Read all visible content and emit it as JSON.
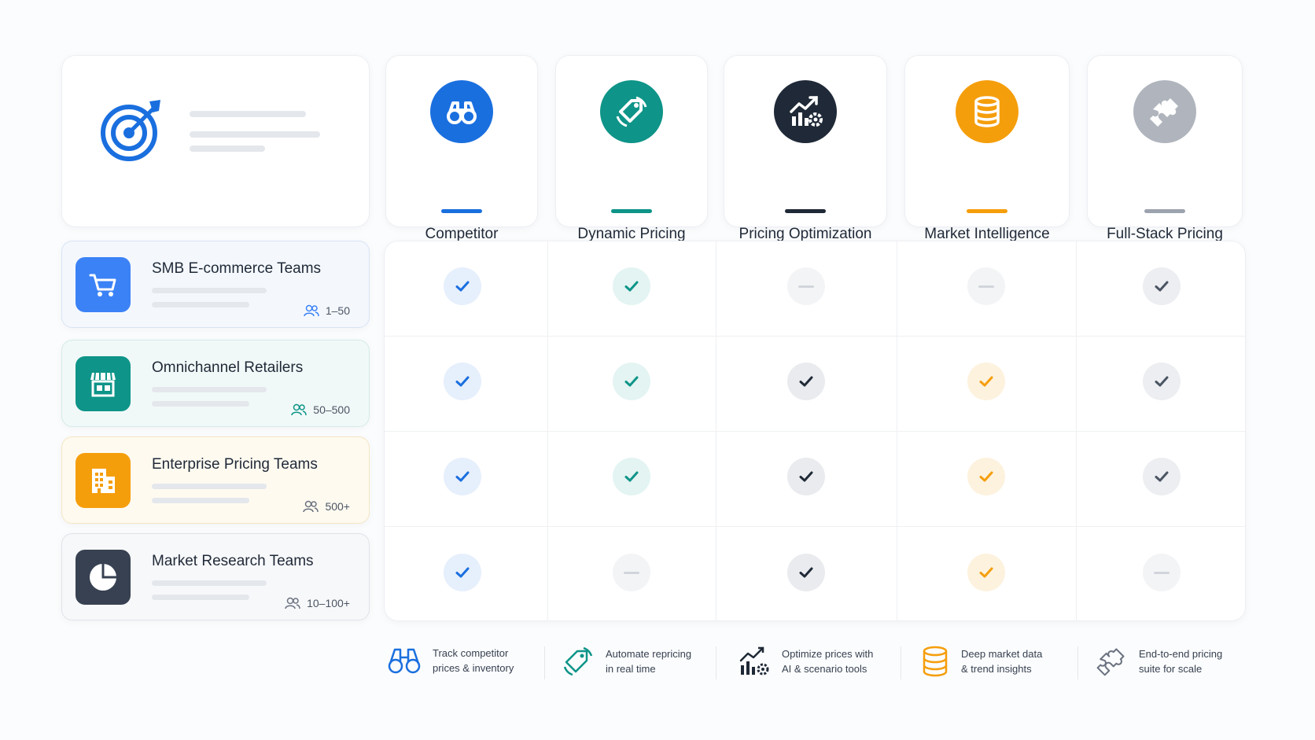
{
  "colors": {
    "blue": "#1a6fdf",
    "teal": "#0e9488",
    "navy": "#1f2937",
    "orange": "#f59e0b",
    "gray": "#9ca3af"
  },
  "columns": [
    {
      "title": "Competitor\nPrice Monitoring",
      "icon": "binoculars-icon",
      "color": "#1a6fdf"
    },
    {
      "title": "Dynamic Pricing\n& Repricing",
      "icon": "price-tag-icon",
      "color": "#0e9488"
    },
    {
      "title": "Pricing Optimization\n& Analytics",
      "icon": "analytics-gear-icon",
      "color": "#1f2937"
    },
    {
      "title": "Market Intelligence\n& Research",
      "icon": "database-icon",
      "color": "#f59e0b"
    },
    {
      "title": "Full-Stack Pricing\nPlatform",
      "icon": "puzzle-icon",
      "color": "#9ca3af"
    }
  ],
  "segments": [
    {
      "name": "SMB E-commerce Teams",
      "size": "1–50",
      "icon": "cart-icon",
      "color": "#3b82f6"
    },
    {
      "name": "Omnichannel Retailers",
      "size": "50–500",
      "icon": "storefront-icon",
      "color": "#0e9488"
    },
    {
      "name": "Enterprise Pricing Teams",
      "size": "500+",
      "icon": "building-icon",
      "color": "#f59e0b"
    },
    {
      "name": "Market Research Teams",
      "size": "10–100+",
      "icon": "pie-chart-icon",
      "color": "#374151"
    }
  ],
  "matrix": [
    [
      true,
      true,
      false,
      false,
      true
    ],
    [
      true,
      true,
      true,
      true,
      true
    ],
    [
      true,
      true,
      true,
      true,
      true
    ],
    [
      true,
      false,
      true,
      true,
      false
    ]
  ],
  "footer": [
    {
      "text": "Track competitor\nprices & inventory",
      "icon": "binoculars-icon"
    },
    {
      "text": "Automate repricing\nin real time",
      "icon": "price-tag-icon"
    },
    {
      "text": "Optimize prices with\nAI & scenario tools",
      "icon": "analytics-gear-icon"
    },
    {
      "text": "Deep market data\n& trend insights",
      "icon": "database-icon"
    },
    {
      "text": "End-to-end pricing\nsuite for scale",
      "icon": "puzzle-icon"
    }
  ]
}
